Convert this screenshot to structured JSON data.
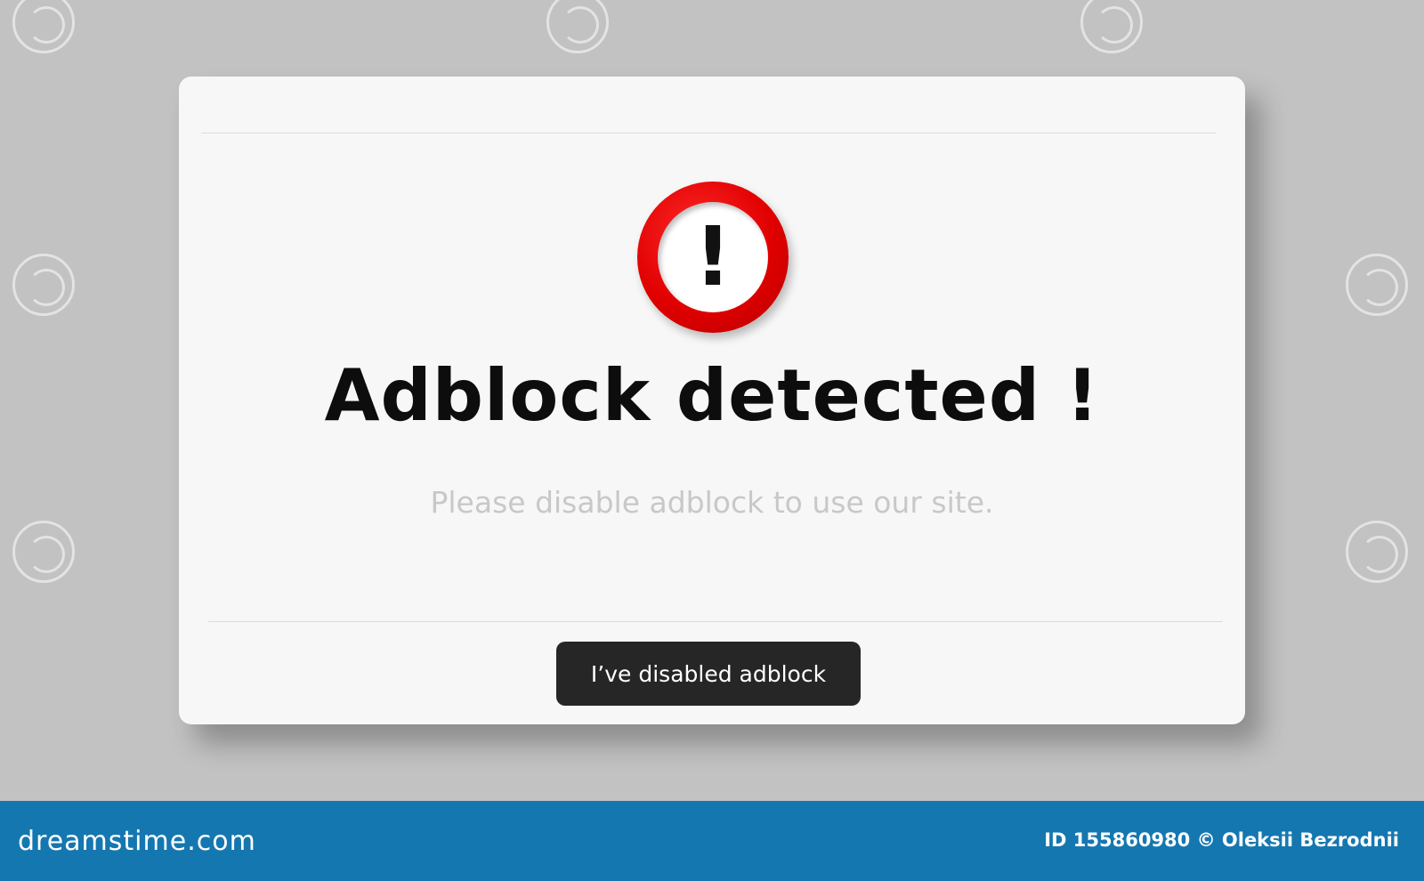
{
  "dialog": {
    "icon": "exclamation-icon",
    "icon_glyph": "!",
    "title": "Adblock detected !",
    "message": "Please disable adblock to use our site.",
    "confirm_label": "I’ve disabled adblock"
  },
  "footer": {
    "brand": "dreamstime.com",
    "credit": "ID 155860980 © Oleksii Bezrodnii"
  },
  "colors": {
    "background": "#c2c2c2",
    "dialog": "#f7f7f7",
    "alert_red": "#e00000",
    "button": "#262626",
    "footer": "#1577b0"
  }
}
